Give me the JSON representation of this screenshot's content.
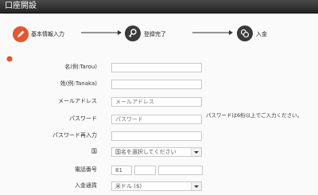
{
  "window": {
    "title": "口座開設"
  },
  "steps": [
    {
      "label": "基本情報入力",
      "icon": "pencil-icon",
      "active": true,
      "color": "#e8542b"
    },
    {
      "label": "登録完了",
      "icon": "key-icon",
      "active": false,
      "color": "#3a3a3a"
    },
    {
      "label": "入金",
      "icon": "coins-icon",
      "active": false,
      "color": "#3a3a3a"
    }
  ],
  "required_icon": "required-mark-icon",
  "form": {
    "last_name": {
      "label": "名(例:Tarou)",
      "value": ""
    },
    "first_name": {
      "label": "姓(例:Tanaka)",
      "value": ""
    },
    "email": {
      "label": "メールアドレス",
      "placeholder": "メールアドレス"
    },
    "password": {
      "label": "パスワード",
      "placeholder": "パスワード",
      "hint": "パスワードは6桁以上でご入力ください。"
    },
    "password_confirm": {
      "label": "パスワード再入力",
      "value": ""
    },
    "country": {
      "label": "国",
      "selected": "国名を選択してください"
    },
    "phone": {
      "label": "電話番号",
      "country_code": "81",
      "part2": "",
      "part3": ""
    },
    "currency": {
      "label": "入金通貨",
      "selected": "米ドル ($)"
    }
  }
}
